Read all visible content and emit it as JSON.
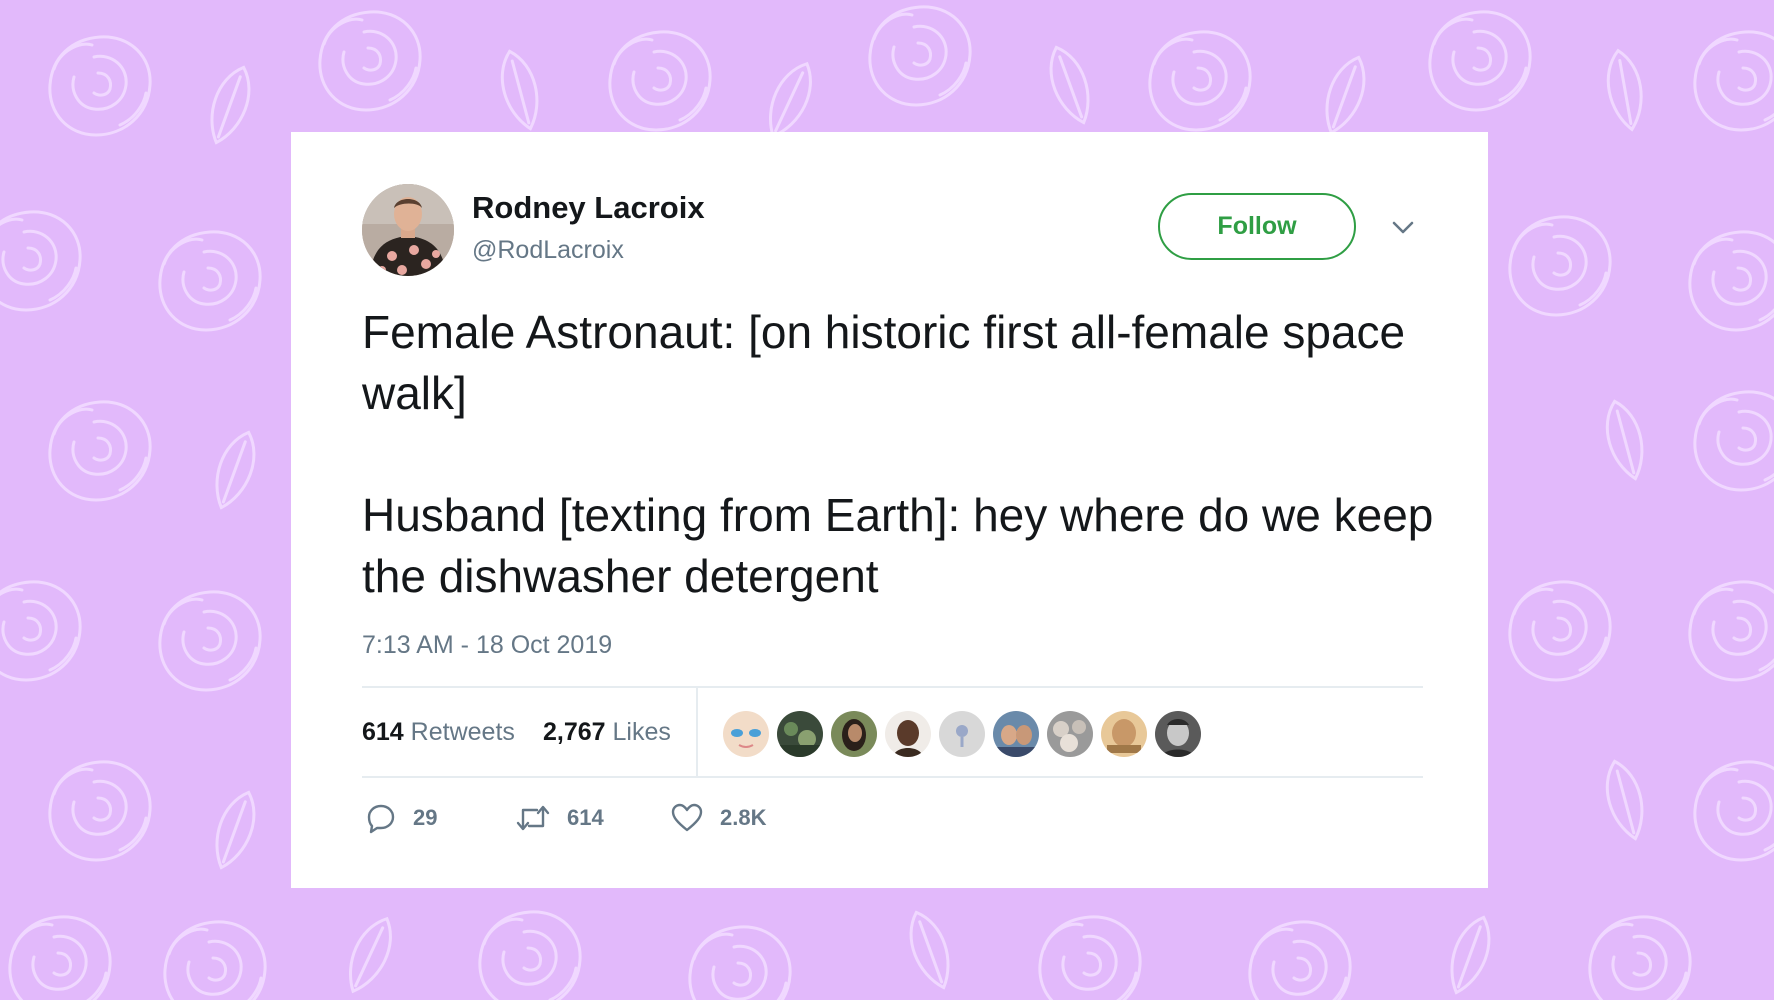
{
  "author": {
    "name": "Rodney Lacroix",
    "handle": "@RodLacroix"
  },
  "header": {
    "follow_label": "Follow"
  },
  "tweet": {
    "paragraphs": [
      "Female Astronaut: [on historic first all-female space walk]",
      "Husband [texting from Earth]: hey where do we keep the dishwasher detergent"
    ],
    "timestamp": "7:13 AM - 18 Oct 2019"
  },
  "stats": {
    "retweets_count": "614",
    "retweets_label": "Retweets",
    "likes_count": "2,767",
    "likes_label": "Likes"
  },
  "actions": {
    "reply_count": "29",
    "retweet_count": "614",
    "like_count": "2.8K"
  },
  "icons": [
    "chevron-down-icon",
    "reply-icon",
    "retweet-icon",
    "heart-icon"
  ],
  "colors": {
    "background": "#e2b9fb",
    "follow_green": "#2f9e44",
    "text_primary": "#14171a",
    "text_secondary": "#657786"
  }
}
